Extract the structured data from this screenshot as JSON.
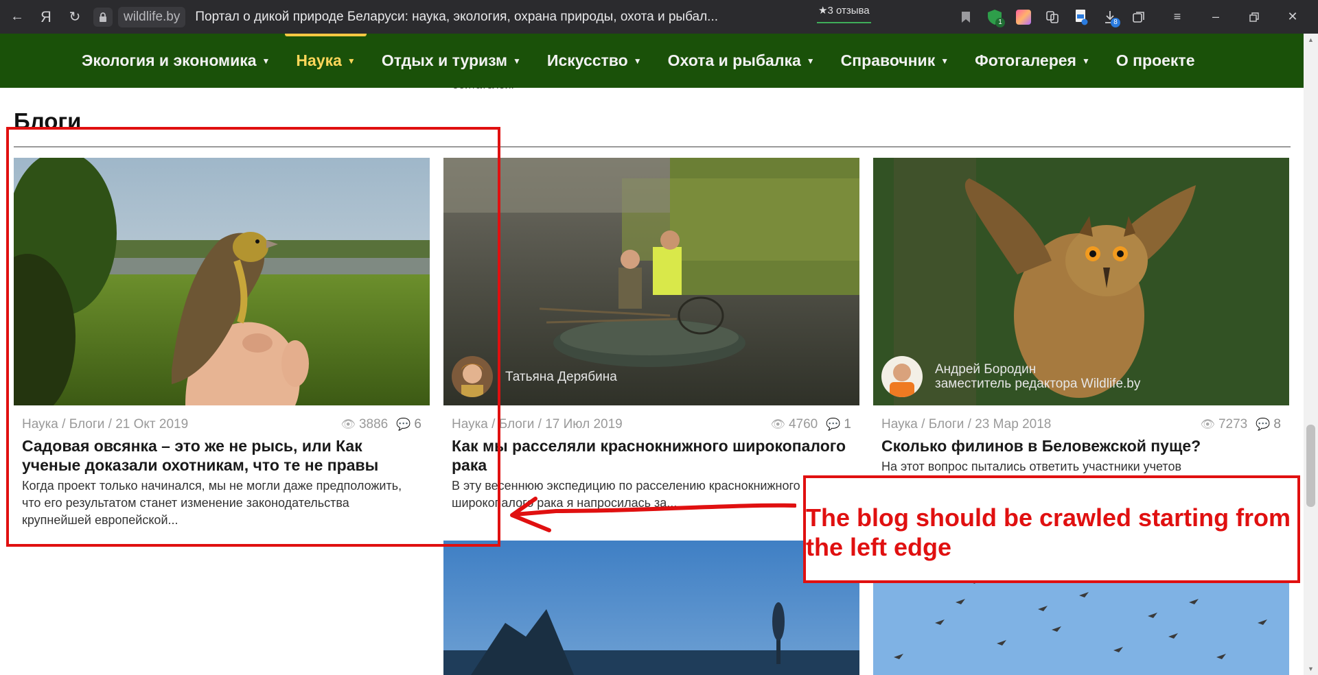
{
  "browser": {
    "domain": "wildlife.by",
    "tab_title": "Портал о дикой природе Беларуси: наука, экология, охрана природы, охота и рыбал...",
    "reviews_label": "★3 отзыва",
    "downloads_badge": "8",
    "shield_badge": "1"
  },
  "nav": {
    "items": [
      {
        "label": "Экология и экономика",
        "has_caret": true
      },
      {
        "label": "Наука",
        "has_caret": true,
        "active": true
      },
      {
        "label": "Отдых и туризм",
        "has_caret": true
      },
      {
        "label": "Искусство",
        "has_caret": true
      },
      {
        "label": "Охота и рыбалка",
        "has_caret": true
      },
      {
        "label": "Справочник",
        "has_caret": true
      },
      {
        "label": "Фотогалерея",
        "has_caret": true
      },
      {
        "label": "О проекте",
        "has_caret": false
      }
    ],
    "peek_text": "обитателей."
  },
  "section": {
    "title": "Блоги"
  },
  "cards": [
    {
      "category": "Наука / Блоги / 21 Окт 2019",
      "views": "3886",
      "comments": "6",
      "title": "Садовая овсянка – это же не рысь, или Как ученые доказали охотникам, что те не правы",
      "excerpt": "Когда проект только начинался, мы не могли даже предположить, что его результатом станет изменение законодательства крупнейшей европейской...",
      "author_name": "",
      "author_role": ""
    },
    {
      "category": "Наука / Блоги / 17 Июл 2019",
      "views": "4760",
      "comments": "1",
      "title": "Как мы расселяли краснокнижного широкопалого рака",
      "excerpt": "В эту весеннюю экспедицию по расселению краснокнижного широкопалого рака я напросилась за...",
      "author_name": "Татьяна Дерябина",
      "author_role": ""
    },
    {
      "category": "Наука / Блоги / 23 Мар 2018",
      "views": "7273",
      "comments": "8",
      "title": "Сколько филинов в Беловежской пуще?",
      "excerpt": "На этот вопрос пытались ответить участники учетов",
      "author_name": "Андрей Бородин",
      "author_role": "заместитель редактора Wildlife.by"
    }
  ],
  "annotation": {
    "note": "The blog should be crawled starting from the left edge"
  },
  "colors": {
    "nav_bg": "#1a5109",
    "nav_active": "#ffd75a",
    "annotation": "#e01010"
  }
}
